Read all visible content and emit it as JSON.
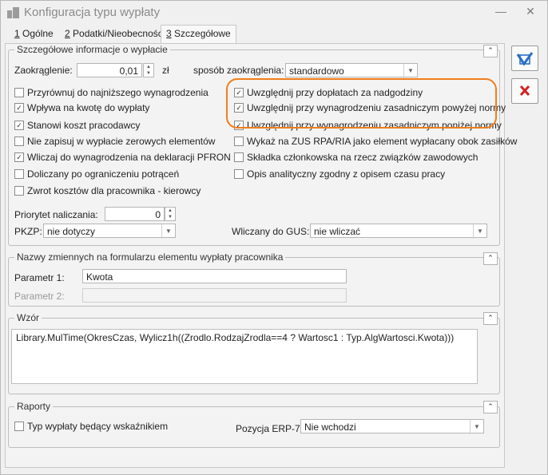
{
  "window": {
    "title": "Konfiguracja typu wypłaty",
    "minimize": "—",
    "close": "✕"
  },
  "tabs": [
    {
      "key": "1",
      "label": " Ogólne"
    },
    {
      "key": "2",
      "label": " Podatki/Nieobecności"
    },
    {
      "key": "3",
      "label": " Szczegółowe"
    }
  ],
  "details": {
    "legend": "Szczegółowe informacje o wypłacie",
    "rounding_label": "Zaokrąglenie:",
    "rounding_value": "0,01",
    "rounding_unit": "zł",
    "rounding_method_label": "sposób zaokrąglenia:",
    "rounding_method_value": "standardowo",
    "left_checks": [
      {
        "label": "Przyrównuj do najniższego wynagrodzenia",
        "checked": false
      },
      {
        "label": "Wpływa na kwotę do wypłaty",
        "checked": true
      },
      {
        "label": "Stanowi koszt pracodawcy",
        "checked": true
      },
      {
        "label": "Nie zapisuj w wypłacie zerowych elementów",
        "checked": false
      },
      {
        "label": "Wliczaj do wynagrodzenia na deklaracji PFRON",
        "checked": true
      },
      {
        "label": "Doliczany po ograniczeniu potrąceń",
        "checked": false
      },
      {
        "label": "Zwrot kosztów dla pracownika - kierowcy",
        "checked": false
      }
    ],
    "right_checks": [
      {
        "label": "Uwzględnij przy dopłatach za nadgodziny",
        "checked": true
      },
      {
        "label": "Uwzględnij przy wynagrodzeniu zasadniczym powyżej normy",
        "checked": true
      },
      {
        "label": "Uwzględnij przy wynagrodzeniu zasadniczym poniżej normy",
        "checked": true
      },
      {
        "label": "Wykaż na ZUS RPA/RIA jako element wypłacany obok zasiłków",
        "checked": false
      },
      {
        "label": "Składka członkowska na rzecz związków zawodowych",
        "checked": false
      },
      {
        "label": "Opis analityczny zgodny z opisem czasu pracy",
        "checked": false
      }
    ],
    "priority_label": "Priorytet naliczania:",
    "priority_value": "0",
    "pkzp_label": "PKZP:",
    "pkzp_value": "nie dotyczy",
    "gus_label": "Wliczany do GUS:",
    "gus_value": "nie wliczać"
  },
  "variables": {
    "legend": "Nazwy zmiennych na formularzu elementu wypłaty pracownika",
    "param1_label": "Parametr 1:",
    "param1_value": "Kwota",
    "param2_label": "Parametr 2:",
    "param2_value": ""
  },
  "formula": {
    "legend": "Wzór",
    "text": "Library.MulTime(OkresCzas, Wylicz1h((Zrodlo.RodzajZrodla==4 ? Wartosc1 : Typ.AlgWartosci.Kwota)))"
  },
  "reports": {
    "legend": "Raporty",
    "indicator_label": "Typ wypłaty będący wskaźnikiem",
    "indicator_checked": false,
    "erp_label": "Pozycja ERP-7:",
    "erp_value": "Nie wchodzi"
  },
  "glyphs": {
    "collapse": "⌃",
    "spin_up": "▲",
    "spin_down": "▼",
    "dropdown": "▼",
    "check": "✓"
  },
  "colors": {
    "highlight": "#f07e1c",
    "save_blue": "#2a6fc9",
    "cancel_red": "#d62020"
  }
}
